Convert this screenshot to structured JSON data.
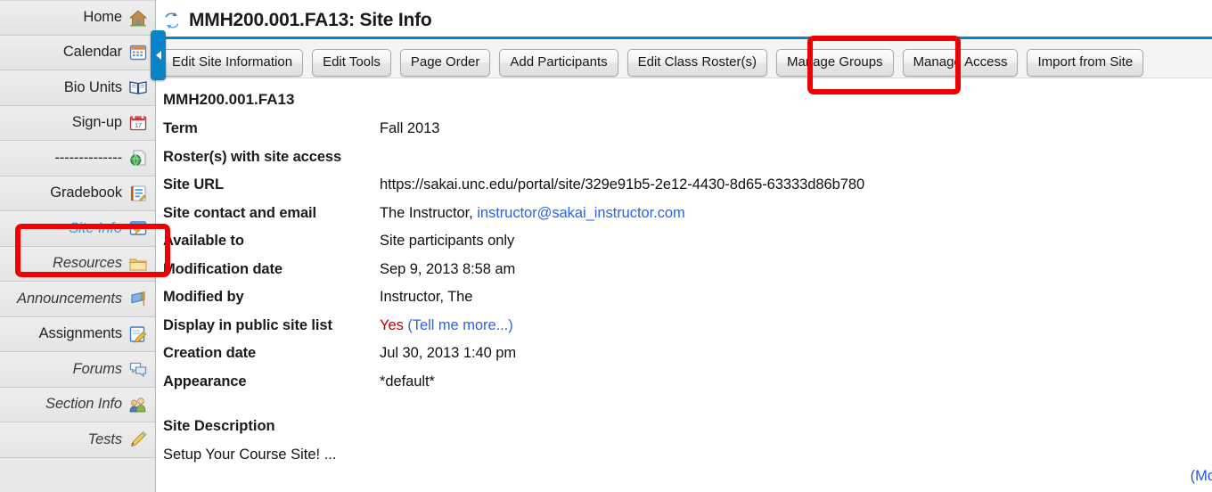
{
  "sidebar": {
    "items": [
      {
        "label": "Home",
        "icon": "home-icon",
        "style": "normal"
      },
      {
        "label": "Calendar",
        "icon": "calendar-icon",
        "style": "normal"
      },
      {
        "label": "Bio Units",
        "icon": "book-icon",
        "style": "normal"
      },
      {
        "label": "Sign-up",
        "icon": "signup-calendar-icon",
        "style": "normal"
      },
      {
        "label": "--------------",
        "icon": "globe-page-icon",
        "style": "normal"
      },
      {
        "label": "Gradebook",
        "icon": "gradebook-icon",
        "style": "normal"
      },
      {
        "label": "Site Info",
        "icon": "site-info-icon",
        "style": "active"
      },
      {
        "label": "Resources",
        "icon": "folder-icon",
        "style": "italic"
      },
      {
        "label": "Announcements",
        "icon": "announcement-flag-icon",
        "style": "italic"
      },
      {
        "label": "Assignments",
        "icon": "assignment-pencil-icon",
        "style": "normal"
      },
      {
        "label": "Forums",
        "icon": "forums-bubble-icon",
        "style": "italic"
      },
      {
        "label": "Section Info",
        "icon": "section-info-people-icon",
        "style": "italic"
      },
      {
        "label": "Tests",
        "icon": "pencil-icon",
        "style": "italic"
      }
    ],
    "collapse_handle": "collapse-sidebar-handle"
  },
  "header": {
    "title": "MMH200.001.FA13: Site Info",
    "icon": "sync-icon",
    "rule_color": "#0a84c8"
  },
  "toolbar": {
    "buttons": [
      "Edit Site Information",
      "Edit Tools",
      "Page Order",
      "Add Participants",
      "Edit Class Roster(s)",
      "Manage Groups",
      "Manage Access",
      "Import from Site"
    ]
  },
  "content": {
    "site_code": "MMH200.001.FA13",
    "rows": [
      {
        "label": "Term",
        "value": "Fall 2013",
        "kind": "text"
      },
      {
        "label": "Roster(s) with site access",
        "value": "",
        "kind": "text"
      },
      {
        "label": "Site URL",
        "value": "https://sakai.unc.edu/portal/site/329e91b5-2e12-4430-8d65-63333d86b780",
        "kind": "text"
      },
      {
        "label": "Site contact and email",
        "value": "The Instructor,",
        "link": "instructor@sakai_instructor.com",
        "kind": "contact"
      },
      {
        "label": "Available to",
        "value": "Site participants only",
        "kind": "text"
      },
      {
        "label": "Modification date",
        "value": "Sep 9, 2013 8:58 am",
        "kind": "text"
      },
      {
        "label": "Modified by",
        "value": "Instructor, The",
        "kind": "text"
      },
      {
        "label": "Display in public site list",
        "value": "Yes",
        "link": "(Tell me more...)",
        "kind": "public"
      },
      {
        "label": "Creation date",
        "value": "Jul 30, 2013 1:40 pm",
        "kind": "text"
      },
      {
        "label": "Appearance",
        "value": "*default*",
        "kind": "text"
      }
    ],
    "description_heading": "Site Description",
    "description_body": "Setup Your Course Site! ...",
    "more_link": "(Mo"
  },
  "annotations": {
    "site_info_highlight": "site-info-highlight",
    "manage_groups_highlight": "manage-groups-highlight",
    "color": "#f00000"
  }
}
